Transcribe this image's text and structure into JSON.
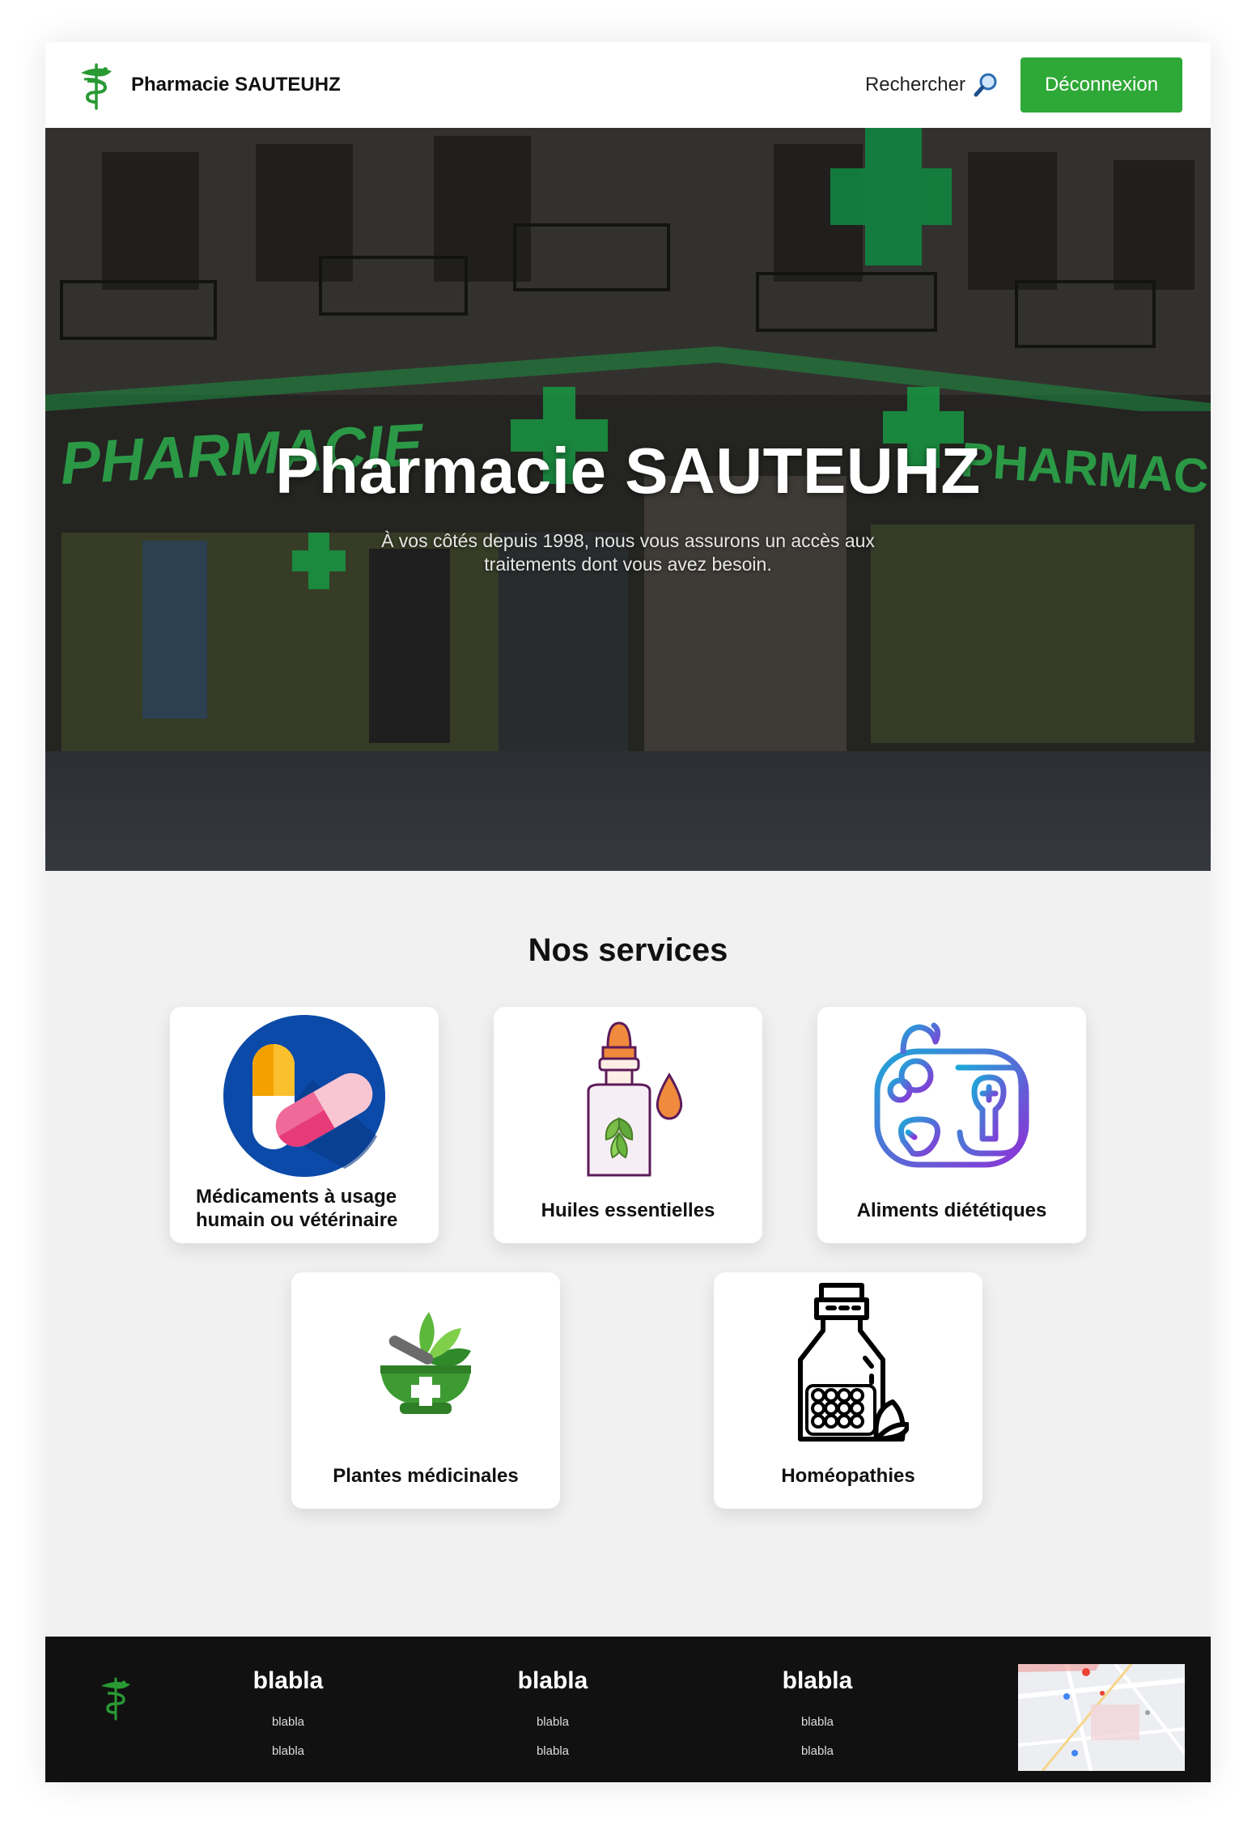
{
  "header": {
    "brand_name": "Pharmacie SAUTEUHZ",
    "search_label": "Rechercher",
    "logout_label": "Déconnexion"
  },
  "hero": {
    "title": "Pharmacie SAUTEUHZ",
    "subtitle": "À vos côtés depuis 1998, nous vous assurons un accès aux traitements dont vous avez besoin.",
    "sign_text": "PHARMACIE"
  },
  "services": {
    "title": "Nos services",
    "items": [
      {
        "label": "Médicaments à usage humain ou vétérinaire",
        "icon": "pill-capsule-icon"
      },
      {
        "label": "Huiles essentielles",
        "icon": "essential-oil-dropper-icon"
      },
      {
        "label": "Aliments diététiques",
        "icon": "diet-food-tray-icon"
      },
      {
        "label": "Plantes médicinales",
        "icon": "mortar-herbs-icon"
      },
      {
        "label": "Homéopathies",
        "icon": "homeopathy-bottle-icon"
      }
    ]
  },
  "footer": {
    "columns": [
      {
        "title": "blabla",
        "links": [
          "blabla",
          "blabla"
        ]
      },
      {
        "title": "blabla",
        "links": [
          "blabla",
          "blabla"
        ]
      },
      {
        "title": "blabla",
        "links": [
          "blabla",
          "blabla"
        ]
      }
    ]
  },
  "colors": {
    "accent_green": "#2ea836",
    "footer_bg": "#111111",
    "page_bg": "#f1f1f1"
  }
}
